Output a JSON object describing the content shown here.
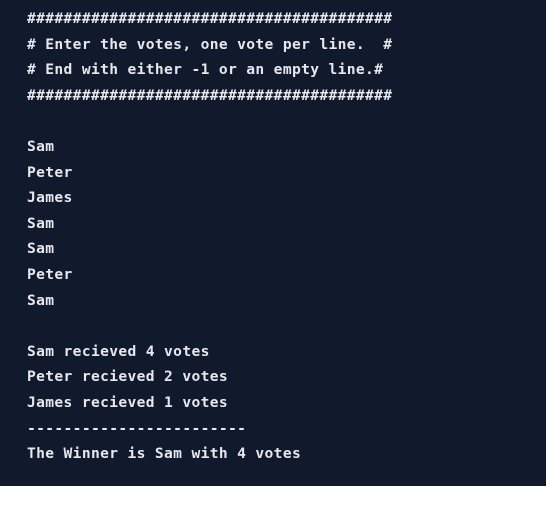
{
  "terminal": {
    "background": "#101a2c",
    "text_color": "#e8e8ec",
    "lines": [
      "########################################",
      "# Enter the votes, one vote per line.  #",
      "# End with either -1 or an empty line.#",
      "########################################",
      "",
      "Sam",
      "Peter",
      "James",
      "Sam",
      "Sam",
      "Peter",
      "Sam",
      "",
      "Sam recieved 4 votes",
      "Peter recieved 2 votes",
      "James recieved 1 votes",
      "------------------------",
      "The Winner is Sam with 4 votes"
    ]
  }
}
